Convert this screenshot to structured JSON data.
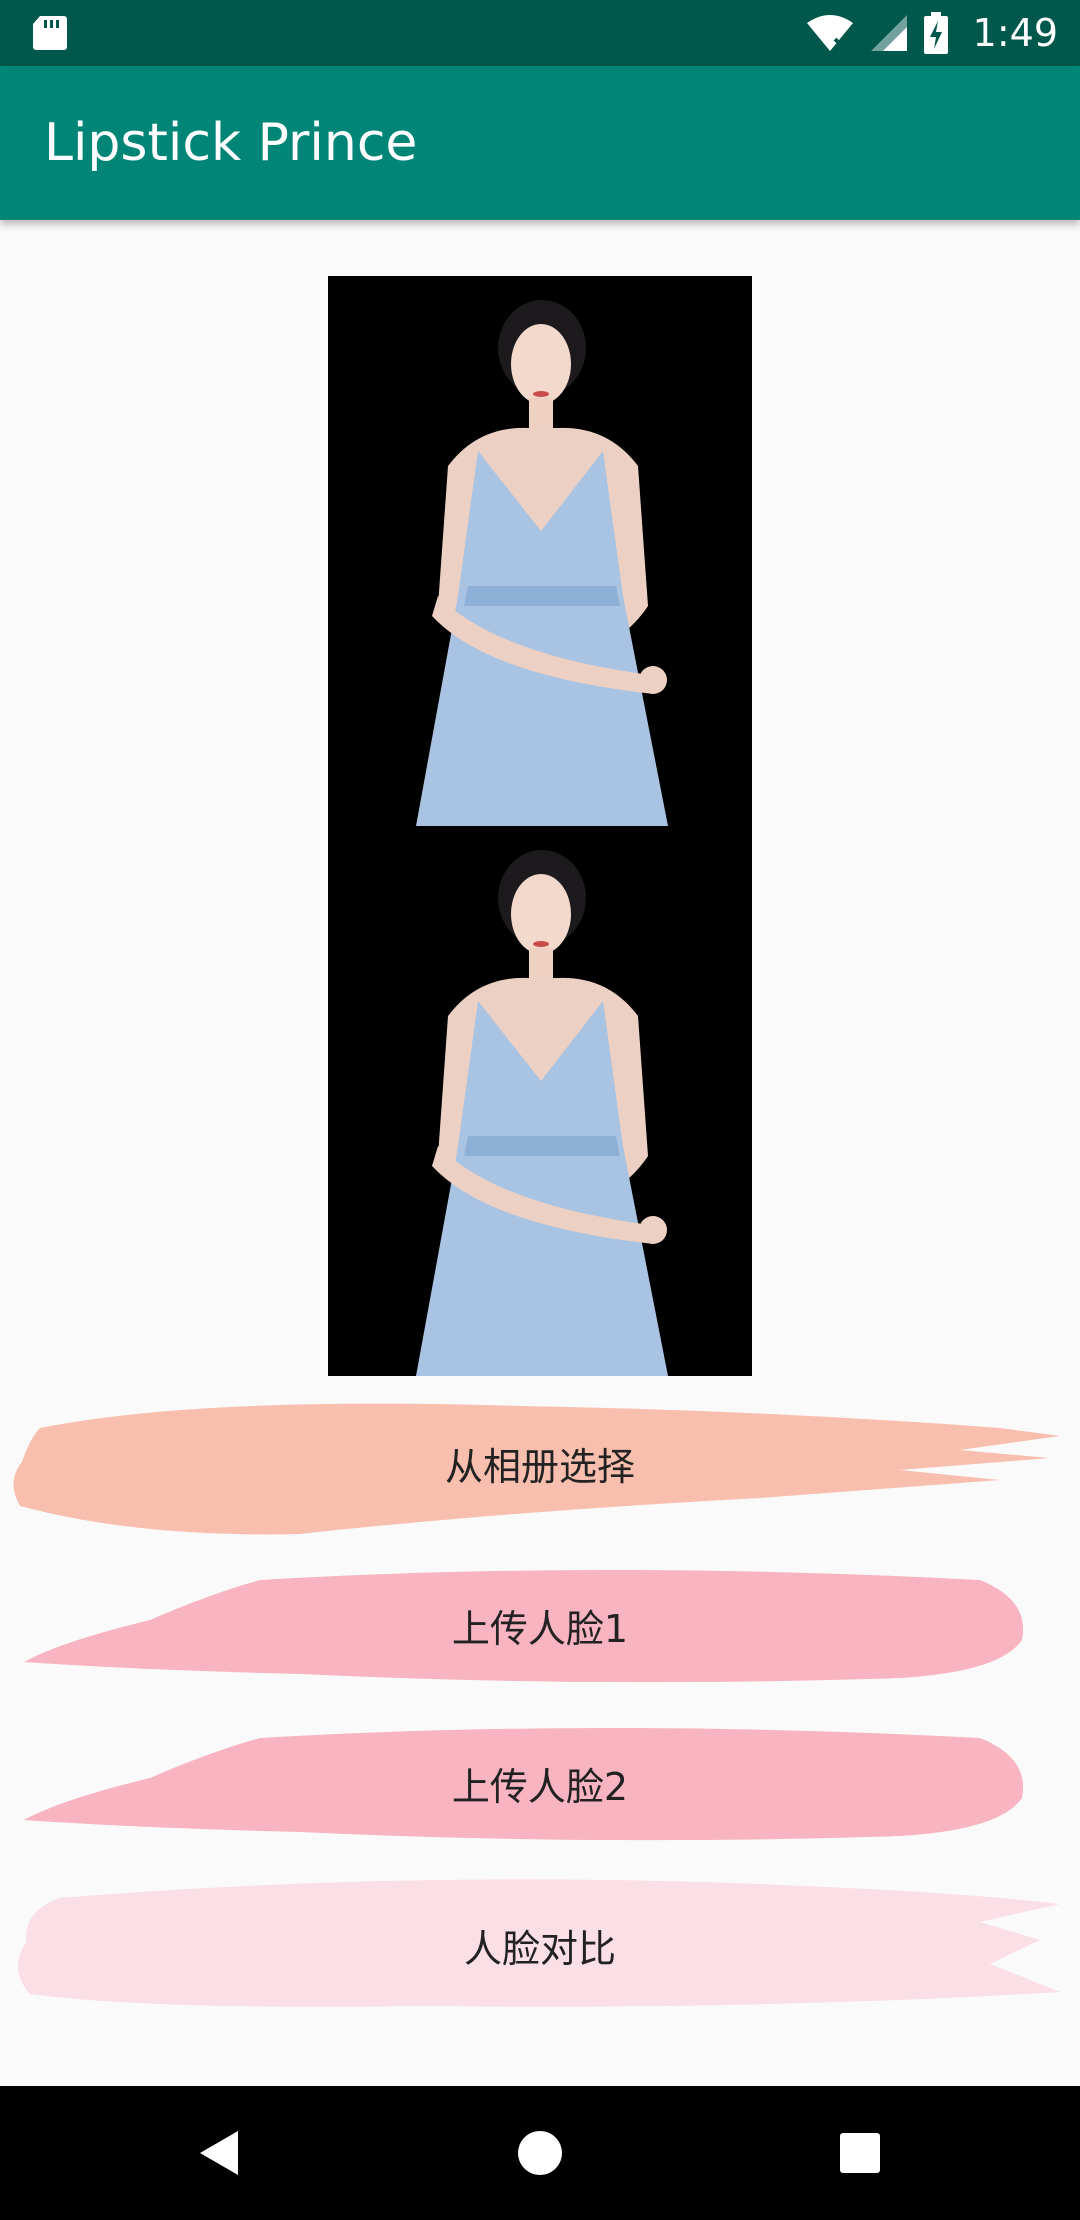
{
  "status_bar": {
    "time": "1:49",
    "icons": [
      "sd-card-icon",
      "wifi-off-icon",
      "signal-icon",
      "battery-charging-icon"
    ]
  },
  "app_bar": {
    "title": "Lipstick Prince",
    "color": "#008577",
    "status_color": "#00574b"
  },
  "image_panel": {
    "count": 2,
    "description_icon": "portrait-photo"
  },
  "buttons": [
    {
      "label": "从相册选择",
      "color": "#f9bfae"
    },
    {
      "label": "上传人脸1",
      "color": "#f8b4c0"
    },
    {
      "label": "上传人脸2",
      "color": "#f8b4c0"
    },
    {
      "label": "人脸对比",
      "color": "#fadfe6"
    }
  ],
  "nav_bar": {
    "icons": [
      "back-icon",
      "home-icon",
      "recents-icon"
    ]
  }
}
